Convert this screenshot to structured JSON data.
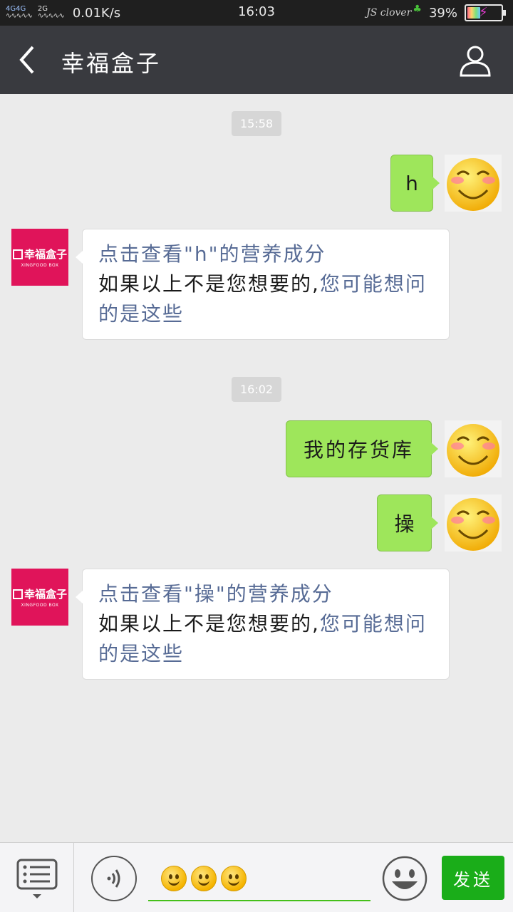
{
  "status_bar": {
    "signal_top": "4G4G",
    "signal_bottom": "",
    "signal2_label": "2G",
    "net_speed": "0.01K/s",
    "time": "16:03",
    "carrier": "JS clover",
    "battery_percent": "39%",
    "battery_level": 0.39
  },
  "header": {
    "back_icon": "chevron-left-icon",
    "title": "幸福盒子",
    "profile_icon": "user-icon"
  },
  "messages": [
    {
      "type": "timestamp",
      "text": "15:58"
    },
    {
      "type": "sent",
      "text": "h",
      "avatar": "smiley-avatar"
    },
    {
      "type": "received",
      "line1": "点击查看\"h\"的营养成分",
      "line2_plain": "如果以上不是您想要的,",
      "line2_link": "您可能想问",
      "line3_link": "的是这些",
      "avatar_brand": "幸福盒子",
      "avatar_sub": "XINGFOOD BOX"
    },
    {
      "type": "timestamp",
      "text": "16:02"
    },
    {
      "type": "sent",
      "text": "我的存货库",
      "avatar": "smiley-avatar"
    },
    {
      "type": "sent",
      "text": "操",
      "avatar": "smiley-avatar"
    },
    {
      "type": "received",
      "line1": "点击查看\"操\"的营养成分",
      "line2_plain": "如果以上不是您想要的,",
      "line2_link": "您可能想问",
      "line3_link": "的是这些",
      "avatar_brand": "幸福盒子",
      "avatar_sub": "XINGFOOD BOX"
    }
  ],
  "input_bar": {
    "menu_icon": "list-menu-icon",
    "voice_icon": "voice-icon",
    "emoji_count": 3,
    "face_icon": "emoji-face-icon",
    "send_label": "发送"
  },
  "colors": {
    "header_bg": "#393a3f",
    "sent_bubble": "#9ee65b",
    "link": "#576b95",
    "send_button": "#1aad19",
    "brand_avatar": "#e0145a"
  }
}
